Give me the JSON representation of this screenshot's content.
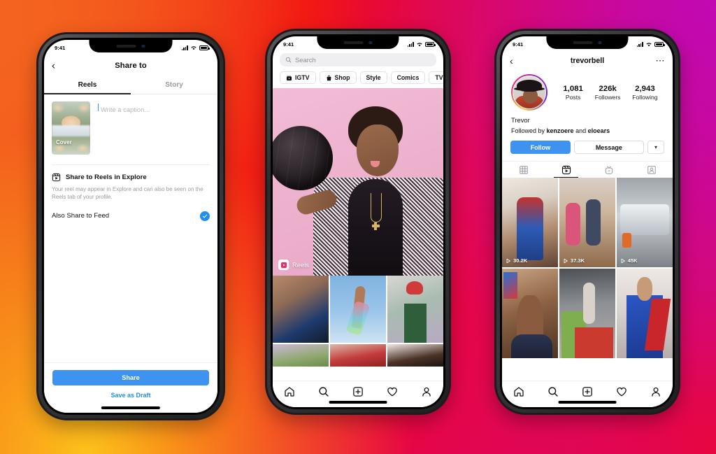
{
  "background": {
    "gradient_colors": [
      "#F4641E",
      "#FCC21B",
      "#F20A10",
      "#E8063F",
      "#C109B3"
    ]
  },
  "phone1": {
    "status_bar": {
      "time": "9:41",
      "signal_icon": "cellular-bars-icon",
      "wifi_icon": "wifi-icon",
      "battery_icon": "battery-icon"
    },
    "back_icon": "chevron-left-icon",
    "title": "Share to",
    "tabs": [
      {
        "label": "Reels",
        "active": true
      },
      {
        "label": "Story",
        "active": false
      }
    ],
    "cover": {
      "label": "Cover"
    },
    "caption": {
      "placeholder": "Write a caption..."
    },
    "explore_option": {
      "icon": "reels-icon",
      "title": "Share to Reels in Explore",
      "description": "Your reel may appear in Explore and can also be seen on the Reels tab of your profile."
    },
    "feed_option": {
      "label": "Also Share to Feed",
      "checked": true,
      "check_icon": "check-icon",
      "accent": "#1d8ef2"
    },
    "share_button": {
      "label": "Share",
      "color": "#3d93ef"
    },
    "draft_button": {
      "label": "Save as Draft",
      "color": "#1d8ef2"
    }
  },
  "phone2": {
    "status_bar": {
      "time": "9:41",
      "signal_icon": "cellular-bars-icon",
      "wifi_icon": "wifi-icon",
      "battery_icon": "battery-icon"
    },
    "search": {
      "placeholder": "Search",
      "icon": "search-icon"
    },
    "chips": [
      {
        "label": "IGTV",
        "icon": "igtv-icon"
      },
      {
        "label": "Shop",
        "icon": "shop-bag-icon"
      },
      {
        "label": "Style",
        "icon": ""
      },
      {
        "label": "Comics",
        "icon": ""
      },
      {
        "label": "TV & Movies",
        "icon": ""
      }
    ],
    "hero": {
      "badge_label": "Reels",
      "badge_icon": "reels-icon"
    },
    "tabbar": [
      {
        "name": "home",
        "icon": "home-icon"
      },
      {
        "name": "search",
        "icon": "search-icon"
      },
      {
        "name": "create",
        "icon": "plus-square-icon"
      },
      {
        "name": "activity",
        "icon": "heart-icon"
      },
      {
        "name": "profile",
        "icon": "person-icon"
      }
    ]
  },
  "phone3": {
    "status_bar": {
      "time": "9:41",
      "signal_icon": "cellular-bars-icon",
      "wifi_icon": "wifi-icon",
      "battery_icon": "battery-icon"
    },
    "back_icon": "chevron-left-icon",
    "username": "trevorbell",
    "more_icon": "more-horizontal-icon",
    "stats": [
      {
        "value": "1,081",
        "label": "Posts"
      },
      {
        "value": "226k",
        "label": "Followers"
      },
      {
        "value": "2,943",
        "label": "Following"
      }
    ],
    "display_name": "Trevor",
    "followed_by": {
      "prefix": "Followed by ",
      "user1": "kenzoere",
      "middle": " and ",
      "user2": "eloears"
    },
    "buttons": {
      "follow": "Follow",
      "message": "Message",
      "chevron_icon": "chevron-down-icon",
      "follow_color": "#3d93ef"
    },
    "profile_tabs": [
      {
        "name": "grid",
        "icon": "grid-icon",
        "active": false
      },
      {
        "name": "reels",
        "icon": "reels-icon",
        "active": true
      },
      {
        "name": "igtv",
        "icon": "igtv-icon",
        "active": false
      },
      {
        "name": "tagged",
        "icon": "tagged-icon",
        "active": false
      }
    ],
    "reels_grid": [
      {
        "views": "30.2K",
        "play_icon": "play-icon"
      },
      {
        "views": "37.3K",
        "play_icon": "play-icon"
      },
      {
        "views": "45K",
        "play_icon": "play-icon"
      },
      {
        "views": "",
        "play_icon": ""
      },
      {
        "views": "",
        "play_icon": ""
      },
      {
        "views": "",
        "play_icon": ""
      }
    ],
    "tabbar": [
      {
        "name": "home",
        "icon": "home-icon"
      },
      {
        "name": "search",
        "icon": "search-icon"
      },
      {
        "name": "create",
        "icon": "plus-square-icon"
      },
      {
        "name": "activity",
        "icon": "heart-icon"
      },
      {
        "name": "profile",
        "icon": "person-icon"
      }
    ]
  }
}
